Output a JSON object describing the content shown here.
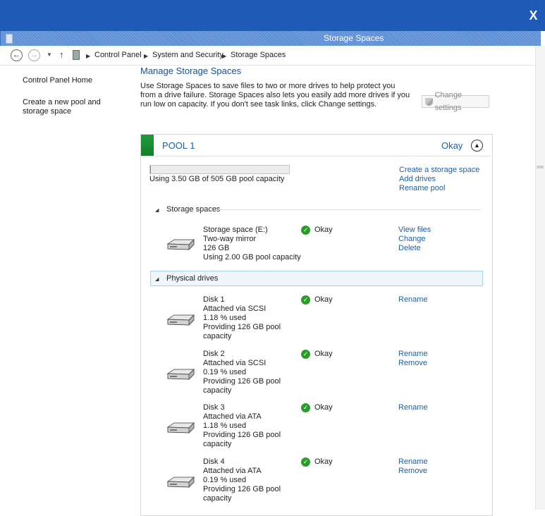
{
  "window": {
    "title": "Storage Spaces",
    "close_label": "X"
  },
  "address": {
    "crumbs": [
      "Control Panel",
      "System and Security",
      "Storage Spaces"
    ]
  },
  "left_nav": {
    "home": "Control Panel Home",
    "create_pool": "Create a new pool and storage space"
  },
  "page": {
    "title": "Manage Storage Spaces",
    "intro": "Use Storage Spaces to save files to two or more drives to help protect you from a drive failure. Storage Spaces also lets you easily add more drives if you run low on capacity. If you don't see task links, click Change settings.",
    "change_settings": "Change settings"
  },
  "pool": {
    "name": "POOL 1",
    "status": "Okay",
    "usage_text": "Using 3.50 GB of 505 GB pool capacity",
    "usage_fraction": 0.0069,
    "links": [
      "Create a storage space",
      "Add drives",
      "Rename pool"
    ],
    "storage_section_title": "Storage spaces",
    "physical_section_title": "Physical drives",
    "space": {
      "lines": [
        "Storage space (E:)",
        "Two-way mirror",
        "126 GB",
        "Using 2.00 GB pool capacity"
      ],
      "status": "Okay",
      "links": [
        "View files",
        "Change",
        "Delete"
      ]
    },
    "drives": [
      {
        "lines": [
          "Disk 1",
          "Attached via SCSI",
          "1.18 % used",
          "Providing 126 GB pool",
          "capacity"
        ],
        "status": "Okay",
        "links": [
          "Rename"
        ]
      },
      {
        "lines": [
          "Disk 2",
          "Attached via SCSI",
          "0.19 % used",
          "Providing 126 GB pool",
          "capacity"
        ],
        "status": "Okay",
        "links": [
          "Rename",
          "Remove"
        ]
      },
      {
        "lines": [
          "Disk 3",
          "Attached via ATA",
          "1.18 % used",
          "Providing 126 GB pool",
          "capacity"
        ],
        "status": "Okay",
        "links": [
          "Rename"
        ]
      },
      {
        "lines": [
          "Disk 4",
          "Attached via ATA",
          "0.19 % used",
          "Providing 126 GB pool",
          "capacity"
        ],
        "status": "Okay",
        "links": [
          "Rename",
          "Remove"
        ]
      }
    ]
  },
  "colors": {
    "accent": "#1e5ab6",
    "link": "#1d5fa8",
    "pool_green": "#1f9b3a",
    "ok_green": "#2a9c2a"
  }
}
